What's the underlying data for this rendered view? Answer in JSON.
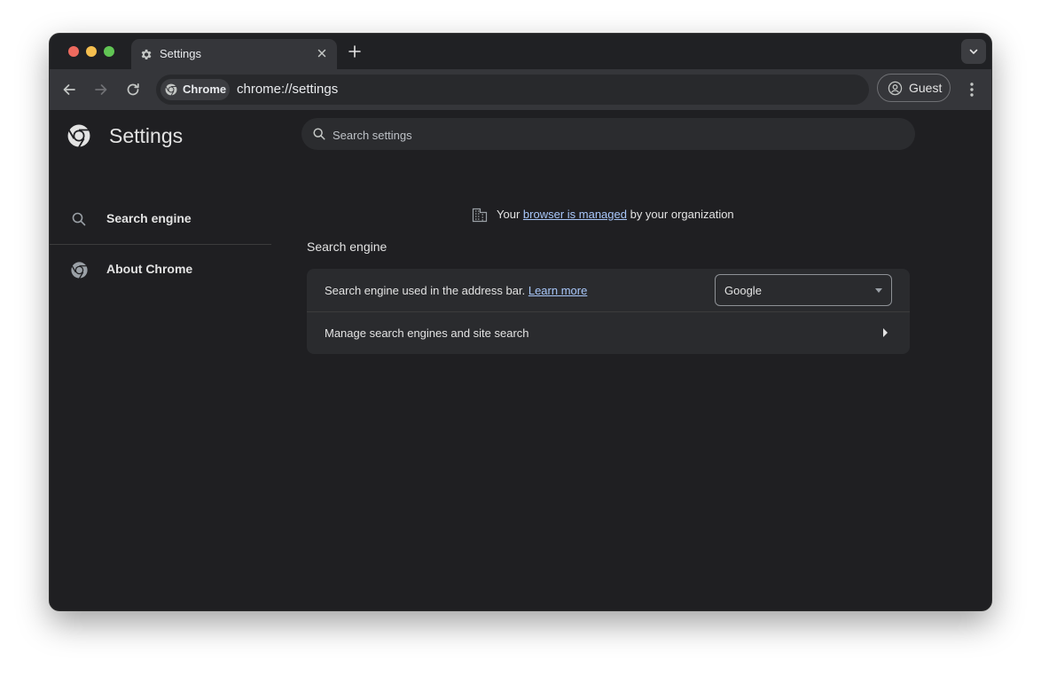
{
  "browser": {
    "tab": {
      "title": "Settings"
    },
    "omnibox": {
      "chip_label": "Chrome",
      "url": "chrome://settings"
    },
    "profile": {
      "label": "Guest"
    }
  },
  "sidebar": {
    "title": "Settings",
    "items": [
      {
        "label": "Search engine",
        "icon": "search-icon"
      },
      {
        "label": "About Chrome",
        "icon": "chrome-logo-icon"
      }
    ]
  },
  "search": {
    "placeholder": "Search settings"
  },
  "managed_notice": {
    "prefix": "Your",
    "link": "browser is managed",
    "suffix": "by your organization"
  },
  "section": {
    "title": "Search engine",
    "rows": [
      {
        "label": "Search engine used in the address bar.",
        "link": "Learn more",
        "select_value": "Google"
      },
      {
        "label": "Manage search engines and site search"
      }
    ]
  },
  "colors": {
    "background": "#1f1f22",
    "link": "#a8c7fa",
    "accent": "#35363a"
  }
}
